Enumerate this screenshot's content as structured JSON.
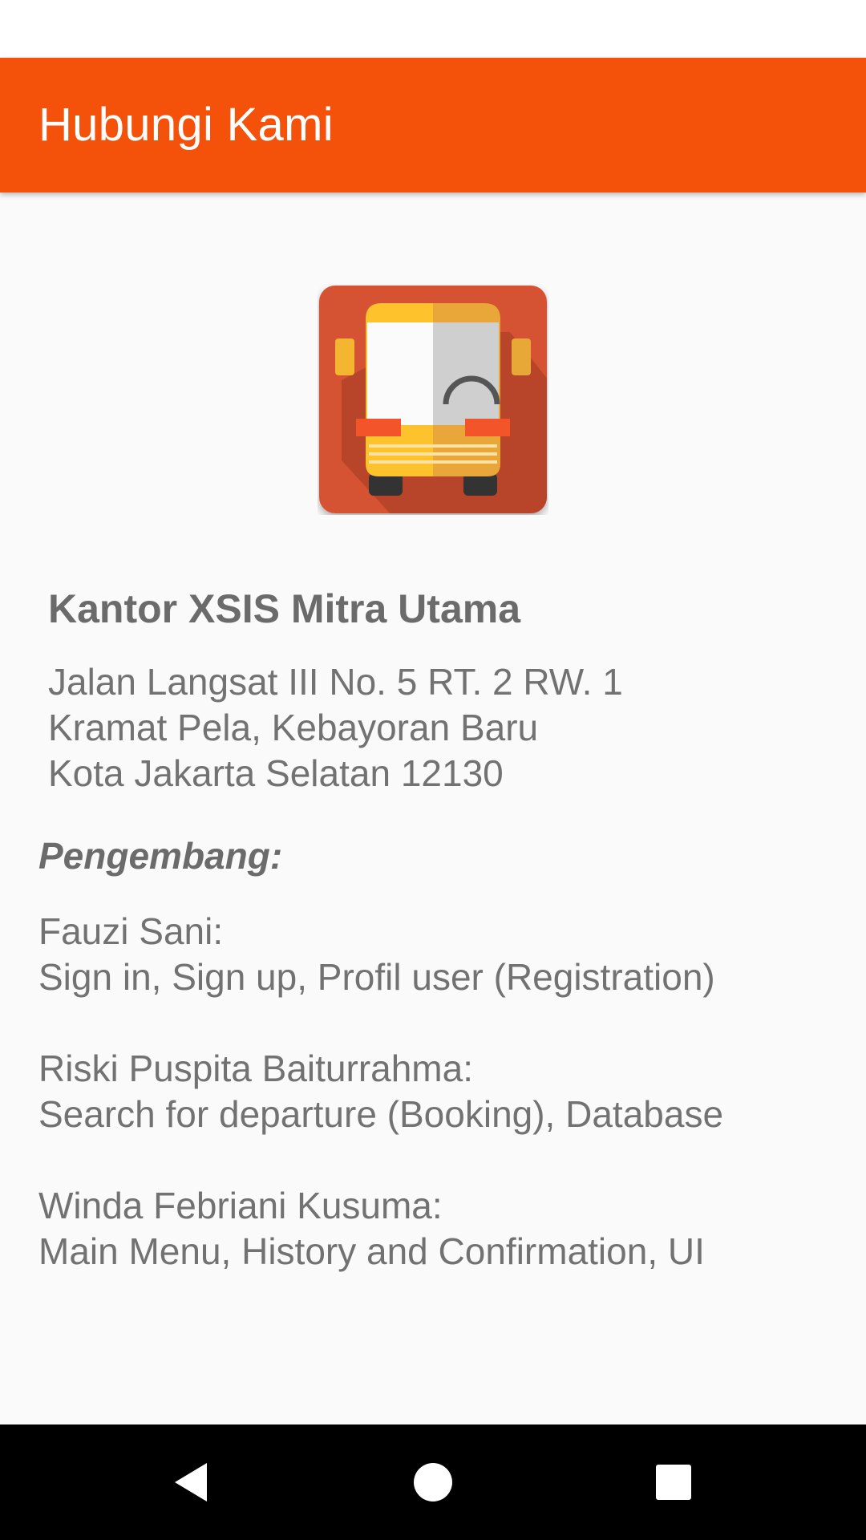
{
  "app_bar": {
    "title": "Hubungi Kami",
    "color": "#f4510b"
  },
  "logo": {
    "icon": "bus-icon"
  },
  "office": {
    "name": "Kantor XSIS Mitra Utama",
    "address_lines": [
      "Jalan Langsat III No. 5 RT. 2 RW. 1",
      "Kramat Pela, Kebayoran Baru",
      "Kota Jakarta Selatan 12130"
    ]
  },
  "developers": {
    "heading": "Pengembang:",
    "entries": [
      {
        "name": "Fauzi Sani:",
        "role": "Sign in, Sign up, Profil user (Registration)"
      },
      {
        "name": "Riski Puspita Baiturrahma:",
        "role": "Search for departure (Booking), Database"
      },
      {
        "name": "Winda Febriani Kusuma:",
        "role": "Main Menu, History and Confirmation, UI"
      }
    ]
  },
  "nav_bar": {
    "back_icon": "back-icon",
    "home_icon": "home-icon",
    "recent_icon": "recent-apps-icon"
  }
}
